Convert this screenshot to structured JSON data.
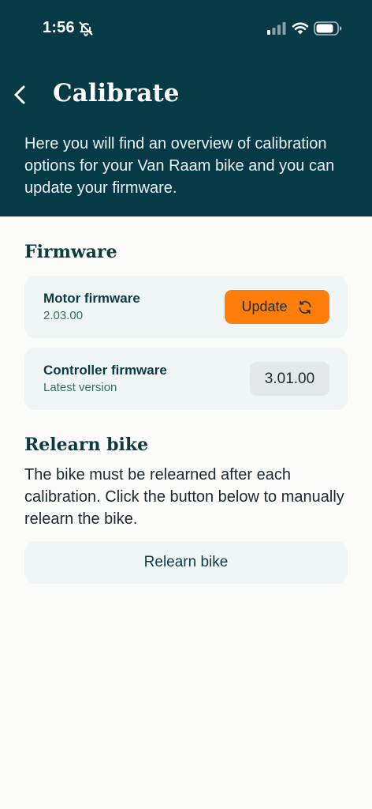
{
  "status_bar": {
    "time": "1:56",
    "icons": [
      "bell-off-icon",
      "signal-icon",
      "wifi-icon",
      "battery-icon"
    ]
  },
  "header": {
    "back_icon": "chevron-left-icon",
    "title": "Calibrate",
    "intro": "Here you will find an overview of calibration options for your Van Raam bike and you can update your firmware."
  },
  "firmware": {
    "section_title": "Firmware",
    "motor": {
      "label": "Motor firmware",
      "version": "2.03.00",
      "update_label": "Update",
      "update_icon": "refresh-icon"
    },
    "controller": {
      "label": "Controller firmware",
      "status": "Latest version",
      "version": "3.01.00"
    }
  },
  "relearn": {
    "section_title": "Relearn bike",
    "description": "The bike must be relearned after each calibration. Click the button below to manually relearn the bike.",
    "button_label": "Relearn bike"
  },
  "colors": {
    "header_bg": "#053a46",
    "accent_orange": "#ff7d0a",
    "card_bg": "#eff4f5",
    "heading_text": "#0b3a42",
    "sub_text": "#2f6e6b"
  }
}
